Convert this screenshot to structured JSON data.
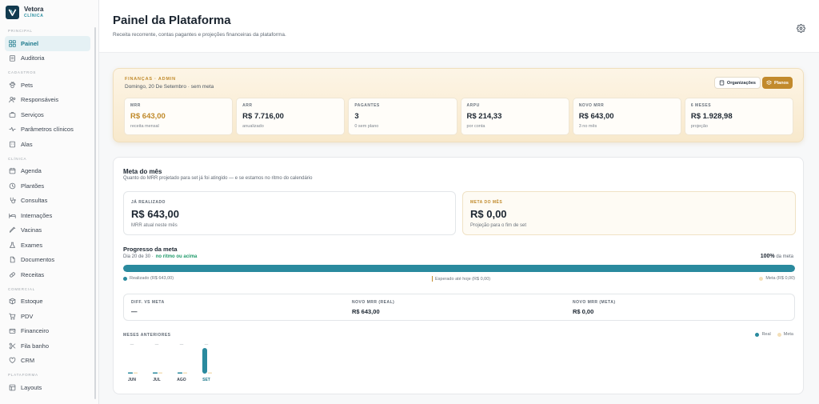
{
  "app": {
    "name": "Vetora",
    "subtitle": "CLÍNICA"
  },
  "sidebar": {
    "sections": [
      {
        "title": "PRINCIPAL",
        "items": [
          {
            "label": "Painel",
            "icon": "grid-icon",
            "active": true
          },
          {
            "label": "Auditoria",
            "icon": "clipboard-icon"
          }
        ]
      },
      {
        "title": "CADASTROS",
        "items": [
          {
            "label": "Pets",
            "icon": "paw-icon"
          },
          {
            "label": "Responsáveis",
            "icon": "users-icon"
          },
          {
            "label": "Serviços",
            "icon": "briefcase-icon"
          },
          {
            "label": "Parâmetros clínicos",
            "icon": "pulse-icon"
          },
          {
            "label": "Alas",
            "icon": "building-icon"
          }
        ]
      },
      {
        "title": "CLÍNICA",
        "items": [
          {
            "label": "Agenda",
            "icon": "calendar-icon"
          },
          {
            "label": "Plantões",
            "icon": "clock-icon"
          },
          {
            "label": "Consultas",
            "icon": "stethoscope-icon"
          },
          {
            "label": "Internações",
            "icon": "bed-icon"
          },
          {
            "label": "Vacinas",
            "icon": "syringe-icon"
          },
          {
            "label": "Exames",
            "icon": "flask-icon"
          },
          {
            "label": "Documentos",
            "icon": "file-icon"
          },
          {
            "label": "Receitas",
            "icon": "pill-icon"
          }
        ]
      },
      {
        "title": "COMERCIAL",
        "items": [
          {
            "label": "Estoque",
            "icon": "box-icon"
          },
          {
            "label": "PDV",
            "icon": "cart-icon"
          },
          {
            "label": "Financeiro",
            "icon": "wallet-icon"
          },
          {
            "label": "Fila banho",
            "icon": "scissors-icon"
          },
          {
            "label": "CRM",
            "icon": "heart-icon"
          }
        ]
      },
      {
        "title": "PLATAFORMA",
        "items": [
          {
            "label": "Layouts",
            "icon": "layout-icon"
          }
        ]
      }
    ]
  },
  "header": {
    "title": "Painel da Plataforma",
    "subtitle": "Receita recorrente, contas pagantes e projeções financeiras da plataforma."
  },
  "finance": {
    "tag": "FINANÇAS · ADMIN",
    "date": "Domingo, 20 De Setembro · sem meta",
    "org_button": "Organizações",
    "plans_button": "Planos",
    "kpis": [
      {
        "label": "MRR",
        "value": "R$ 643,00",
        "sub": "receita mensal",
        "highlight": true
      },
      {
        "label": "ARR",
        "value": "R$ 7.716,00",
        "sub": "anualizado"
      },
      {
        "label": "PAGANTES",
        "value": "3",
        "sub": "0 sem plano"
      },
      {
        "label": "ARPU",
        "value": "R$ 214,33",
        "sub": "por conta"
      },
      {
        "label": "NOVO MRR",
        "value": "R$ 643,00",
        "sub": "3 no mês"
      },
      {
        "label": "6 MESES",
        "value": "R$ 1.928,98",
        "sub": "projeção"
      }
    ]
  },
  "goal": {
    "title": "Meta do mês",
    "subtitle": "Quanto do MRR projetado para set já foi atingido — e se estamos no ritmo do calendário",
    "realized": {
      "label": "JÁ REALIZADO",
      "value": "R$ 643,00",
      "sub": "MRR atual neste mês"
    },
    "target": {
      "label": "META DO MÊS",
      "value": "R$ 0,00",
      "sub": "Projeção para o fim de set"
    },
    "progress": {
      "title": "Progresso da meta",
      "day": "Dia 20 de 30 ·",
      "status": "no ritmo ou acima",
      "percent": "100%",
      "percent_suffix": "da meta",
      "fill": 1.0,
      "legend_realized": "Realizado (R$ 643,00)",
      "legend_expected": "Esperado até hoje (R$ 0,00)",
      "legend_target": "Meta (R$ 0,00)"
    },
    "diff": [
      {
        "label": "DIFF. VS META",
        "value": "—"
      },
      {
        "label": "NOVO MRR (REAL)",
        "value": "R$ 643,00"
      },
      {
        "label": "NOVO MRR (META)",
        "value": "R$ 0,00"
      }
    ],
    "previous": {
      "title": "MESES ANTERIORES",
      "legend_real": "Real",
      "legend_meta": "Meta"
    },
    "colors": {
      "real": "#2a8a9e",
      "meta": "#f3dfb8",
      "gold": "#c08a2b"
    }
  },
  "chart_data": {
    "type": "bar",
    "categories": [
      "JUN",
      "JUL",
      "AGO",
      "SET"
    ],
    "series": [
      {
        "name": "Real",
        "values": [
          0,
          0,
          0,
          643
        ]
      },
      {
        "name": "Meta",
        "values": [
          0,
          0,
          0,
          0
        ]
      }
    ],
    "top_labels": [
      "—",
      "—",
      "—",
      "—"
    ]
  }
}
